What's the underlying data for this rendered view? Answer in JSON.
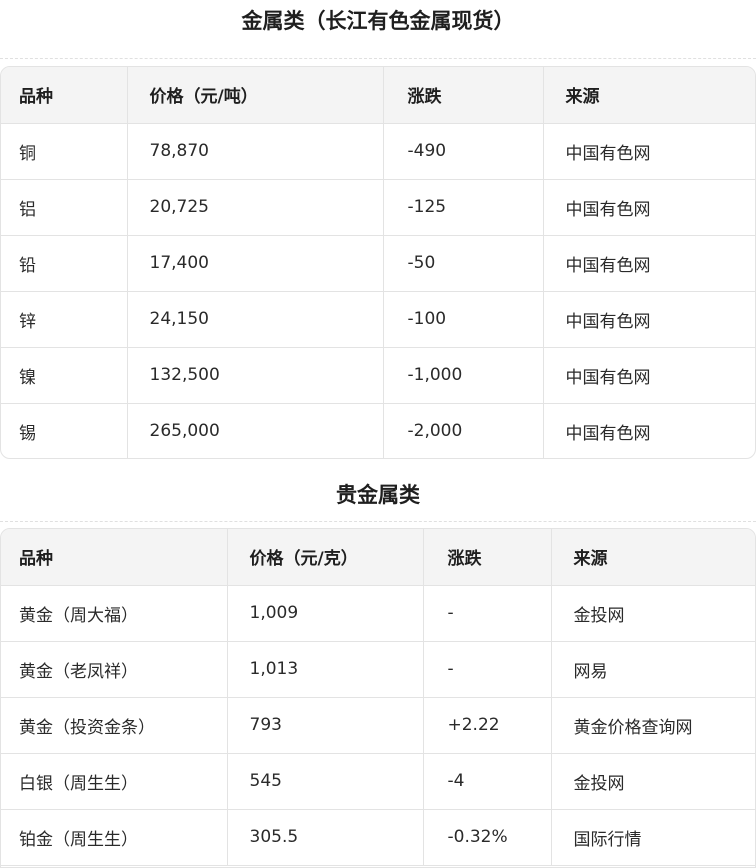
{
  "base_metals": {
    "title": "金属类（长江有色金属现货）",
    "headers": [
      "品种",
      "价格（元/吨）",
      "涨跌",
      "来源"
    ],
    "rows": [
      {
        "name": "铜",
        "price": "78,870",
        "change": "-490",
        "source": "中国有色网"
      },
      {
        "name": "铝",
        "price": "20,725",
        "change": "-125",
        "source": "中国有色网"
      },
      {
        "name": "铅",
        "price": "17,400",
        "change": "-50",
        "source": "中国有色网"
      },
      {
        "name": "锌",
        "price": "24,150",
        "change": "-100",
        "source": "中国有色网"
      },
      {
        "name": "镍",
        "price": "132,500",
        "change": "-1,000",
        "source": "中国有色网"
      },
      {
        "name": "锡",
        "price": "265,000",
        "change": "-2,000",
        "source": "中国有色网"
      }
    ]
  },
  "precious_metals": {
    "title": "贵金属类",
    "headers": [
      "品种",
      "价格（元/克）",
      "涨跌",
      "来源"
    ],
    "rows": [
      {
        "name": "黄金（周大福）",
        "price": "1,009",
        "change": "-",
        "source": "金投网"
      },
      {
        "name": "黄金（老凤祥）",
        "price": "1,013",
        "change": "-",
        "source": "网易"
      },
      {
        "name": "黄金（投资金条）",
        "price": "793",
        "change": "+2.22",
        "source": "黄金价格查询网"
      },
      {
        "name": "白银（周生生）",
        "price": "545",
        "change": "-4",
        "source": "金投网"
      },
      {
        "name": "铂金（周生生）",
        "price": "305.5",
        "change": "-0.32%",
        "source": "国际行情"
      }
    ]
  }
}
